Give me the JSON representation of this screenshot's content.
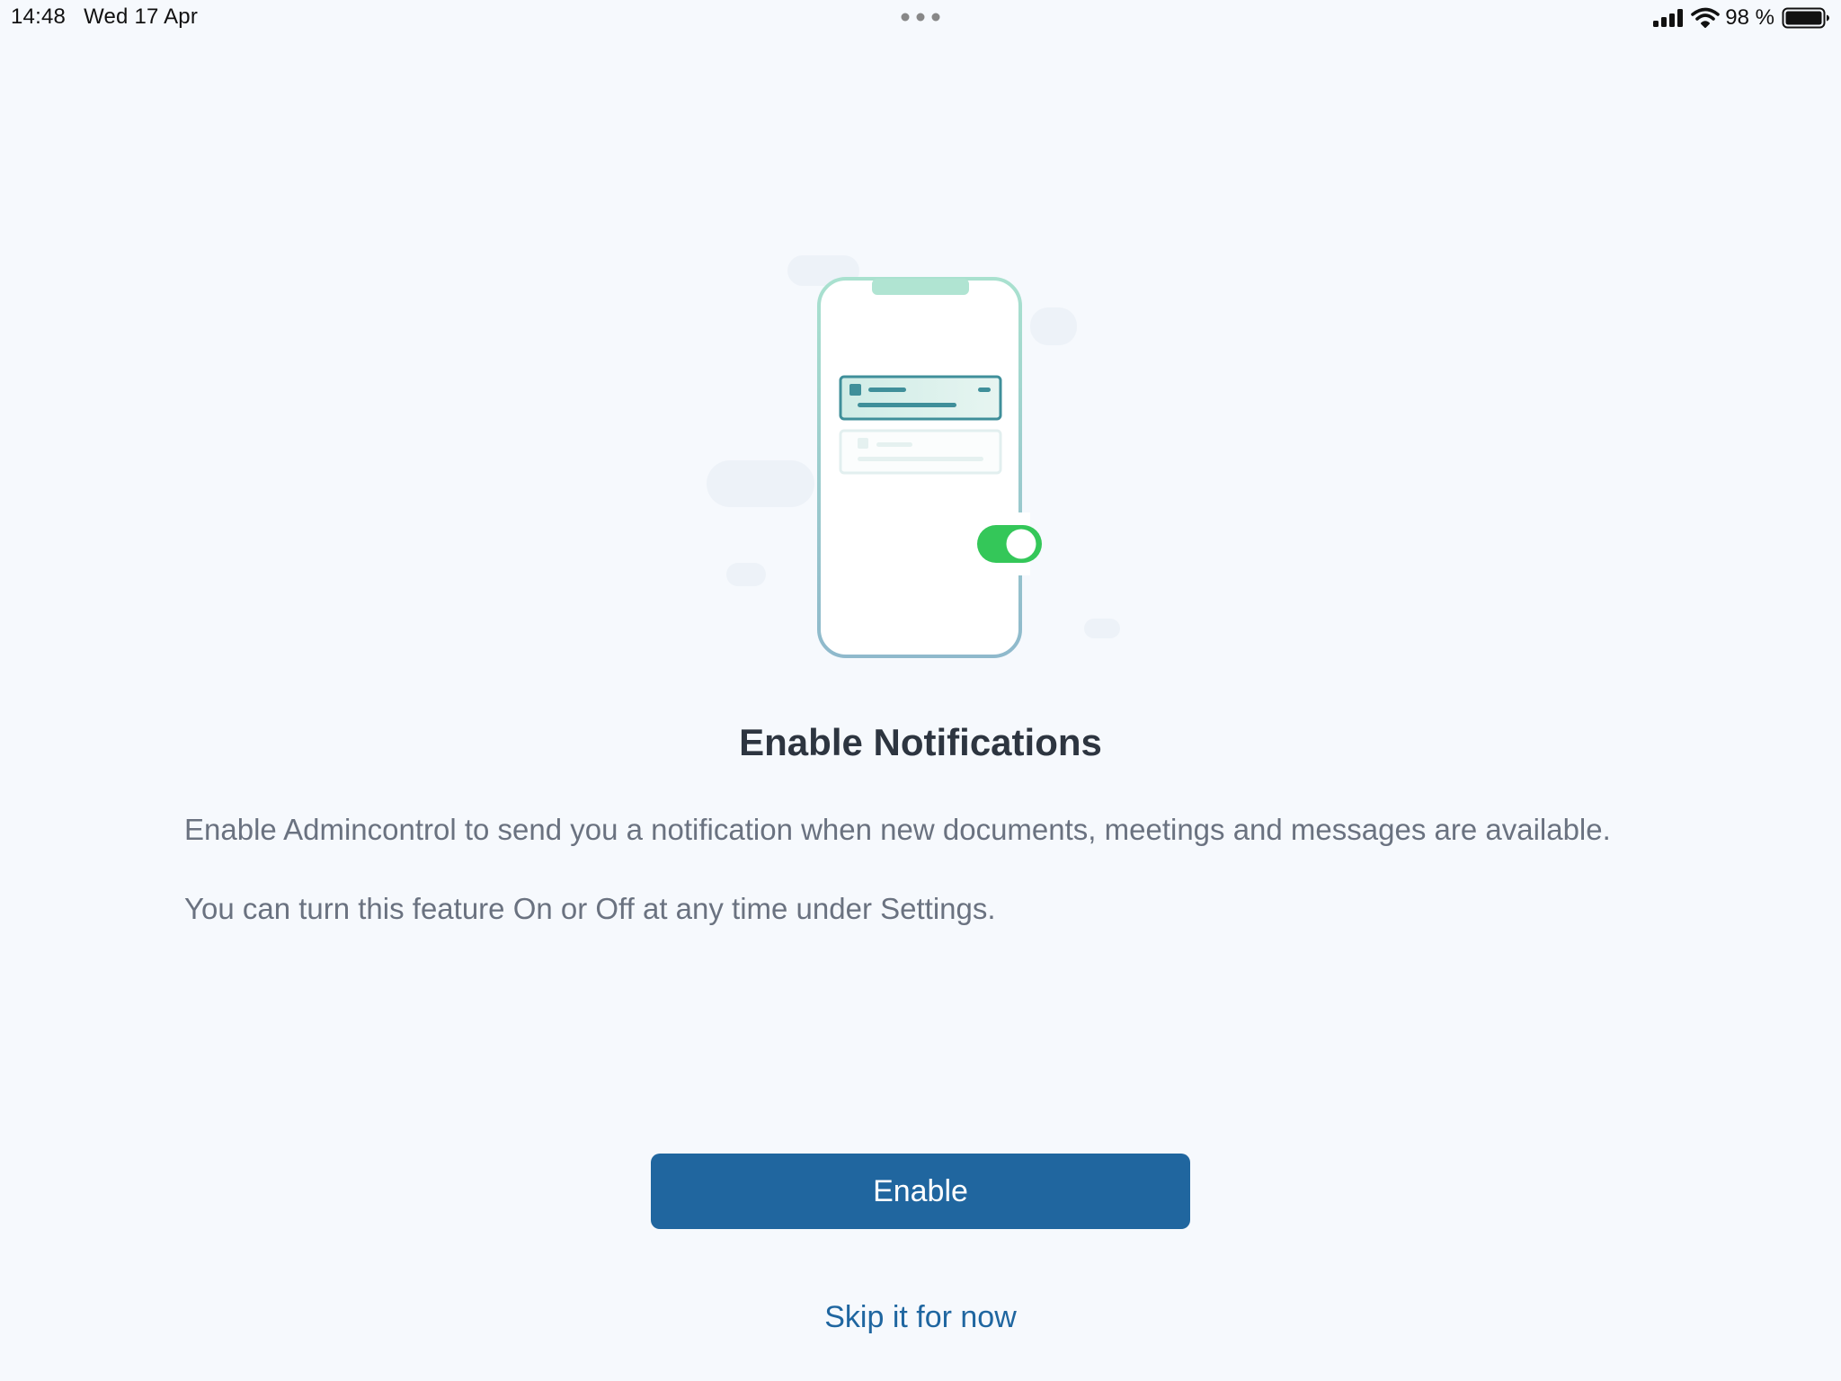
{
  "status_bar": {
    "time": "14:48",
    "date": "Wed 17 Apr",
    "battery_percent": "98 %",
    "icons": [
      "cellular-signal-icon",
      "wifi-icon",
      "battery-icon"
    ]
  },
  "onboarding": {
    "title": "Enable Notifications",
    "description": "Enable Admincontrol to send you a notification when new documents, meetings and messages are available.",
    "settings_note": "You can turn this feature On or Off at any time under Settings.",
    "enable_button_label": "Enable",
    "skip_link_label": "Skip it for now"
  },
  "colors": {
    "background": "#f6f9fd",
    "primary_button": "#20669f",
    "link": "#1f66a0",
    "toggle_on": "#34c759",
    "phone_outline": "#a6dccd"
  }
}
